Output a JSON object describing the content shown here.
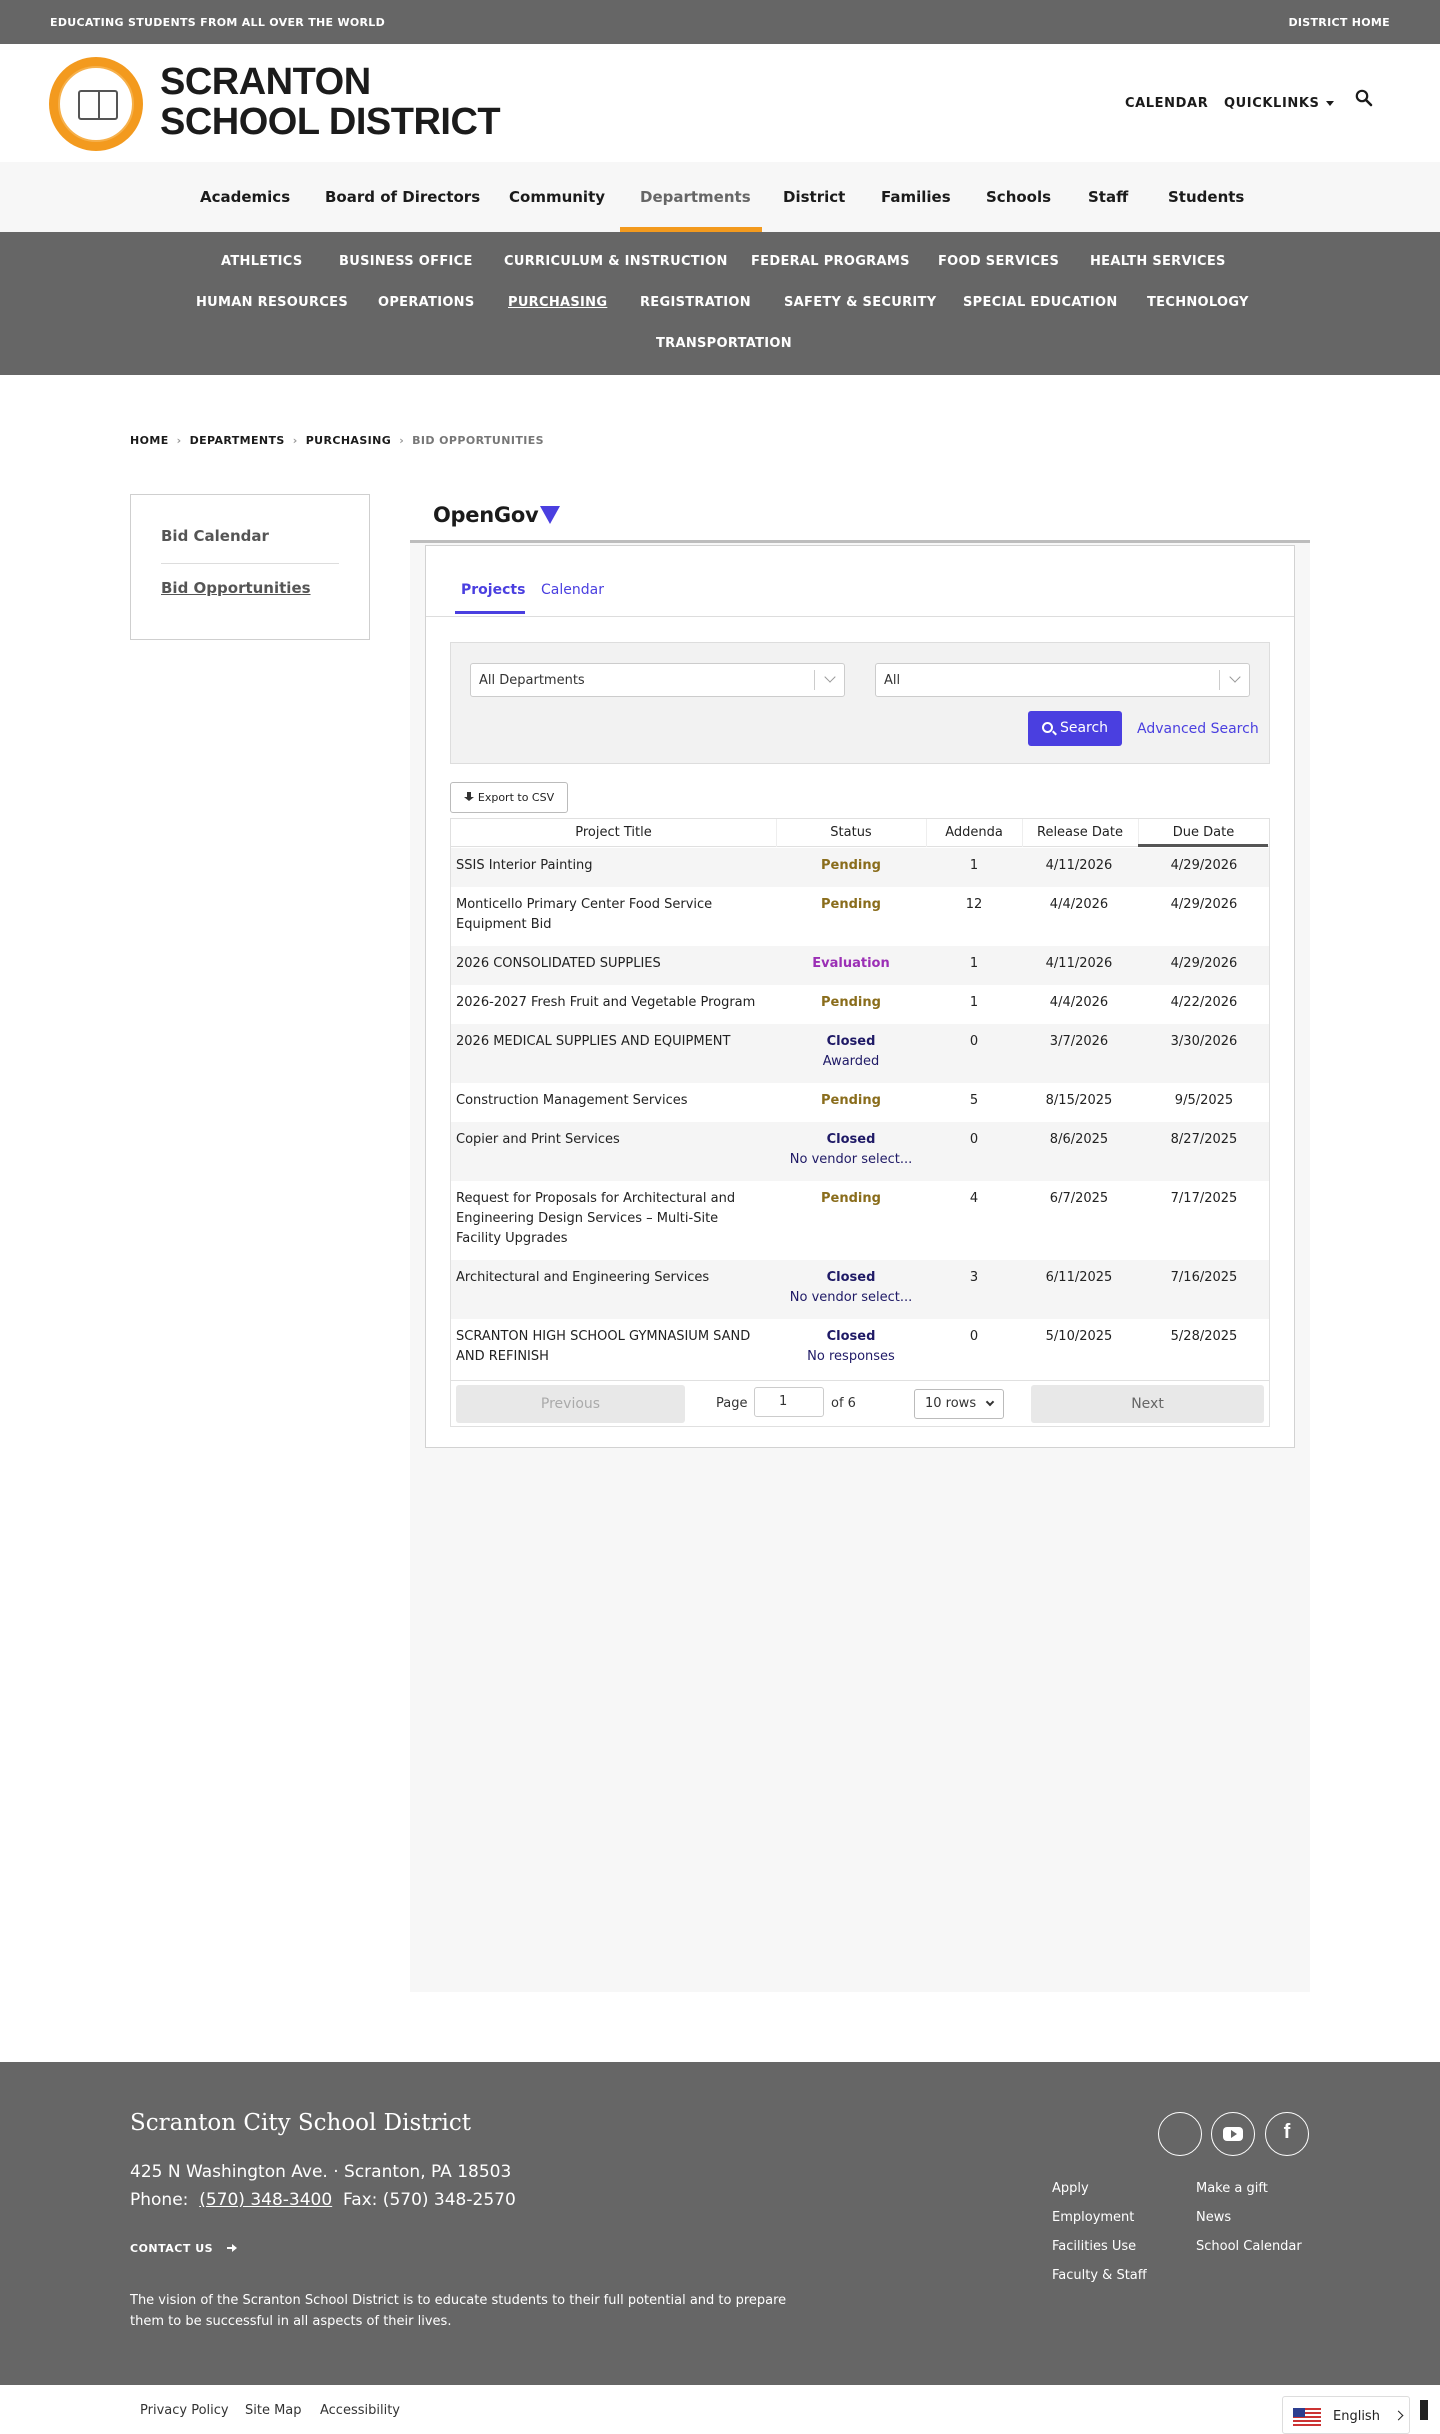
{
  "topbar": {
    "tagline": "EDUCATING STUDENTS FROM ALL OVER THE WORLD",
    "district_home": "DISTRICT HOME"
  },
  "header": {
    "site_name_line1": "SCRANTON",
    "site_name_line2": "SCHOOL DISTRICT",
    "calendar": "CALENDAR",
    "quicklinks": "QUICKLINKS",
    "logo_text": "SCRANTON SCHOOL DISTRICT"
  },
  "main_nav": [
    "Academics",
    "Board of Directors",
    "Community",
    "Departments",
    "District",
    "Families",
    "Schools",
    "Staff",
    "Students"
  ],
  "sub_nav": {
    "row1": [
      "ATHLETICS",
      "BUSINESS OFFICE",
      "CURRICULUM & INSTRUCTION",
      "FEDERAL PROGRAMS",
      "FOOD SERVICES",
      "HEALTH SERVICES"
    ],
    "row2": [
      "HUMAN RESOURCES",
      "OPERATIONS",
      "PURCHASING",
      "REGISTRATION",
      "SAFETY & SECURITY",
      "SPECIAL EDUCATION",
      "TECHNOLOGY"
    ],
    "row3": [
      "TRANSPORTATION"
    ]
  },
  "breadcrumb": [
    "HOME",
    "DEPARTMENTS",
    "PURCHASING",
    "BID OPPORTUNITIES"
  ],
  "sidenav": [
    "Bid Calendar",
    "Bid Opportunities"
  ],
  "widget": {
    "brand": "OpenGov",
    "tabs": [
      "Projects",
      "Calendar"
    ],
    "filter_department": "All Departments",
    "filter_status": "All",
    "search_button": "Search",
    "advanced_search": "Advanced Search",
    "export_button": "Export to CSV",
    "columns": [
      "Project Title",
      "Status",
      "Addenda",
      "Release Date",
      "Due Date"
    ],
    "rows": [
      {
        "title": "SSIS Interior Painting",
        "status": "Pending",
        "sub": "",
        "addenda": "1",
        "release": "4/11/2026",
        "due": "4/29/2026"
      },
      {
        "title": "Monticello Primary Center Food Service Equipment Bid",
        "status": "Pending",
        "sub": "",
        "addenda": "12",
        "release": "4/4/2026",
        "due": "4/29/2026"
      },
      {
        "title": "2026 CONSOLIDATED SUPPLIES",
        "status": "Evaluation",
        "sub": "",
        "addenda": "1",
        "release": "4/11/2026",
        "due": "4/29/2026"
      },
      {
        "title": "2026-2027 Fresh Fruit and Vegetable Program",
        "status": "Pending",
        "sub": "",
        "addenda": "1",
        "release": "4/4/2026",
        "due": "4/22/2026"
      },
      {
        "title": "2026 MEDICAL SUPPLIES AND EQUIPMENT",
        "status": "Closed",
        "sub": "Awarded",
        "addenda": "0",
        "release": "3/7/2026",
        "due": "3/30/2026"
      },
      {
        "title": "Construction Management Services",
        "status": "Pending",
        "sub": "",
        "addenda": "5",
        "release": "8/15/2025",
        "due": "9/5/2025"
      },
      {
        "title": "Copier and Print Services",
        "status": "Closed",
        "sub": "No vendor select...",
        "addenda": "0",
        "release": "8/6/2025",
        "due": "8/27/2025"
      },
      {
        "title": "Request for Proposals for Architectural and Engineering Design Services – Multi-Site Facility Upgrades",
        "status": "Pending",
        "sub": "",
        "addenda": "4",
        "release": "6/7/2025",
        "due": "7/17/2025"
      },
      {
        "title": "Architectural and Engineering Services",
        "status": "Closed",
        "sub": "No vendor select...",
        "addenda": "3",
        "release": "6/11/2025",
        "due": "7/16/2025"
      },
      {
        "title": "SCRANTON HIGH SCHOOL GYMNASIUM SAND AND REFINISH",
        "status": "Closed",
        "sub": "No responses",
        "addenda": "0",
        "release": "5/10/2025",
        "due": "5/28/2025"
      }
    ],
    "pager": {
      "previous": "Previous",
      "page_label": "Page",
      "page": "1",
      "of": "of 6",
      "rows": "10 rows",
      "next": "Next"
    }
  },
  "footer": {
    "title": "Scranton City School District",
    "address": "425 N Washington Ave.  · Scranton, PA  18503",
    "phone_label": "Phone:",
    "phone": "(570) 348-3400",
    "fax": "Fax: (570) 348-2570",
    "contact": "CONTACT US",
    "vision": "The vision of the Scranton School District is to educate students to their full potential and to prepare them to be successful in all aspects of their lives.",
    "links_col1": [
      "Apply",
      "Employment",
      "Facilities Use",
      "Faculty & Staff"
    ],
    "links_col2": [
      "Make a gift",
      "News",
      "School Calendar"
    ]
  },
  "bottombar": {
    "links": [
      "Privacy Policy",
      "Site Map",
      "Accessibility"
    ],
    "language": "English"
  },
  "colors": {
    "accent": "#f39a1e",
    "gray_band": "#666666",
    "opengov": "#4a3fe0"
  }
}
